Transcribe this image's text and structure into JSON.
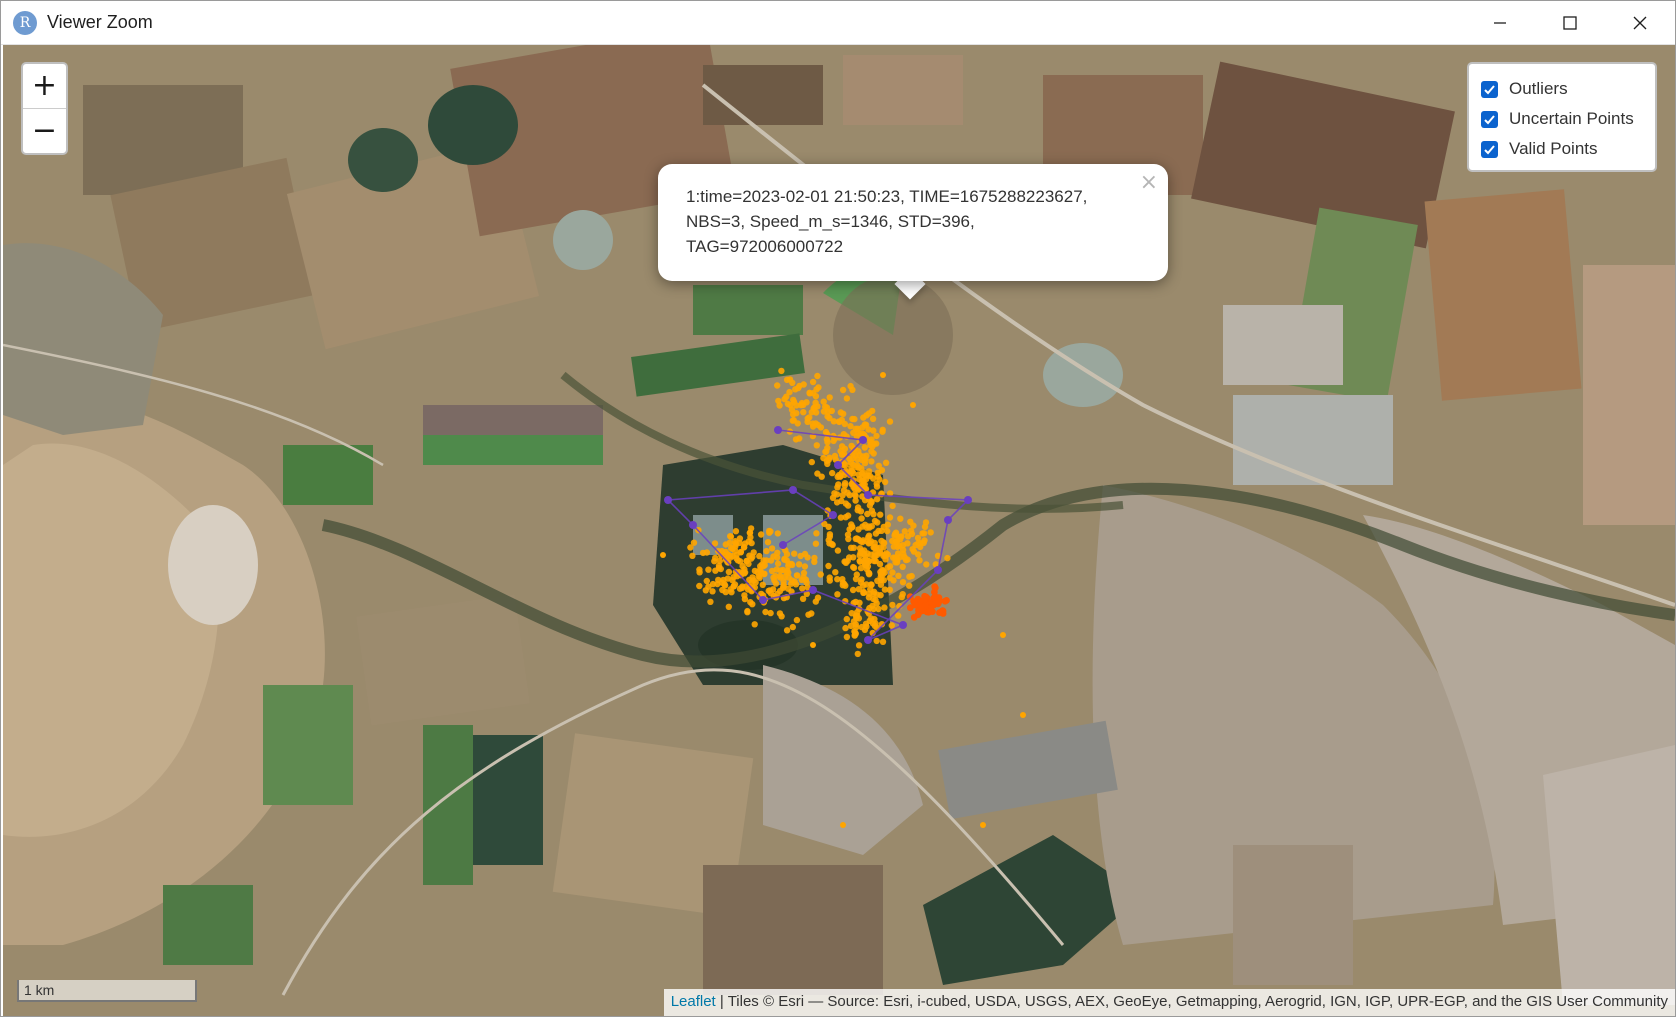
{
  "window": {
    "title": "Viewer Zoom",
    "app_icon_letter": "R",
    "controls": [
      "minimize-icon",
      "maximize-icon",
      "close-icon"
    ]
  },
  "map": {
    "zoom_in_label": "+",
    "zoom_out_label": "−",
    "layers": [
      {
        "label": "Outliers",
        "checked": true
      },
      {
        "label": "Uncertain Points",
        "checked": true
      },
      {
        "label": "Valid Points",
        "checked": true
      }
    ],
    "popup": {
      "line1": "1:time=2023-02-01 21:50:23, TIME=1675288223627,",
      "line2": "NBS=3, Speed_m_s=1346, STD=396,",
      "line3": "TAG=972006000722",
      "close": "×"
    },
    "scale_label": "1 km",
    "attribution": {
      "link_text": "Leaflet",
      "text": " | Tiles © Esri — Source: Esri, i-cubed, USDA, USGS, AEX, GeoEye, Getmapping, Aerogrid, IGN, IGP, UPR-EGP, and the GIS User Community"
    },
    "colors": {
      "outliers": "#ffa500",
      "uncertain": "#ff5a00",
      "valid": "#6a3fc0"
    }
  }
}
